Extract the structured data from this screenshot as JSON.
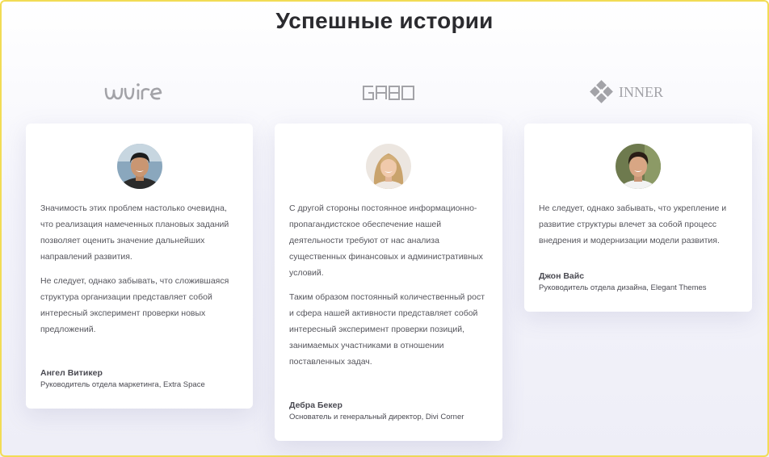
{
  "section": {
    "title": "Успешные истории"
  },
  "logos": [
    {
      "icon": "uiire-logo"
    },
    {
      "icon": "gabo-logo"
    },
    {
      "icon": "inner-logo",
      "text": "INNER"
    }
  ],
  "testimonials": [
    {
      "paragraphs": [
        "Значимость этих проблем настолько очевидна, что реализация намеченных плановых заданий позволяет оценить значение дальнейших направлений развития.",
        "Не следует, однако забывать, что сложившаяся структура организации представляет собой интересный эксперимент проверки новых предложений."
      ],
      "author": "Ангел Витикер",
      "role": "Руководитель отдела маркетинга, Extra Space"
    },
    {
      "paragraphs": [
        "С другой стороны постоянное информационно-пропагандистское обеспечение нашей деятельности требуют от нас анализа существенных финансовых и административных условий.",
        "Таким образом постоянный количественный рост и сфера нашей активности представляет собой интересный эксперимент проверки позиций, занимаемых участниками в отношении поставленных задач."
      ],
      "author": "Дебра Бекер",
      "role": "Основатель и генеральный директор, Divi Corner"
    },
    {
      "paragraphs": [
        "Не следует, однако забывать, что укрепление и развитие структуры влечет за собой процесс внедрения и модернизации модели развития."
      ],
      "author": "Джон Вайс",
      "role": "Руководитель отдела дизайна, Elegant Themes"
    }
  ],
  "colors": {
    "frame": "#f2dc55",
    "title": "#2b2b2f",
    "text": "#55555c",
    "logo": "#a3a3a8"
  }
}
